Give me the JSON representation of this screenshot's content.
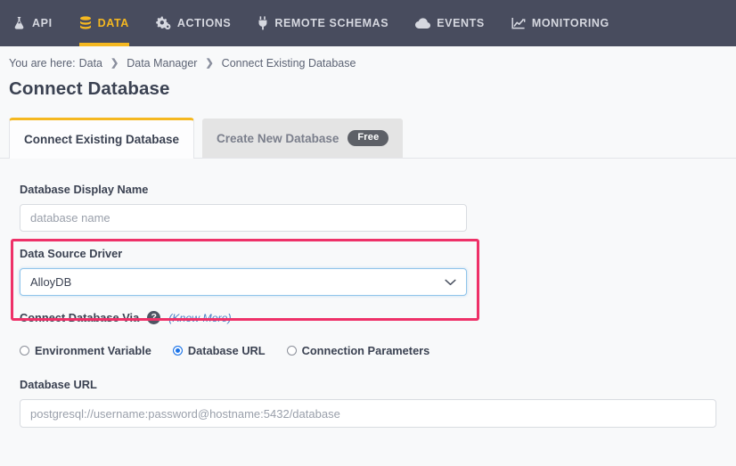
{
  "nav": {
    "items": [
      {
        "label": "API",
        "icon": "flask-icon",
        "active": false
      },
      {
        "label": "DATA",
        "icon": "database-icon",
        "active": true
      },
      {
        "label": "ACTIONS",
        "icon": "gears-icon",
        "active": false
      },
      {
        "label": "REMOTE SCHEMAS",
        "icon": "plug-icon",
        "active": false
      },
      {
        "label": "EVENTS",
        "icon": "cloud-icon",
        "active": false
      },
      {
        "label": "MONITORING",
        "icon": "line-chart-icon",
        "active": false
      }
    ],
    "active_color": "#f5b820",
    "background": "#484c5e"
  },
  "breadcrumb": {
    "prefix": "You are here:",
    "items": [
      "Data",
      "Data Manager",
      "Connect Existing Database"
    ],
    "separator": "❯"
  },
  "page": {
    "title": "Connect Database"
  },
  "tabs": [
    {
      "label": "Connect Existing Database",
      "active": true,
      "badge": null
    },
    {
      "label": "Create New Database",
      "active": false,
      "badge": "Free"
    }
  ],
  "form": {
    "display_name": {
      "label": "Database Display Name",
      "placeholder": "database name",
      "value": ""
    },
    "driver": {
      "label": "Data Source Driver",
      "selected": "AlloyDB",
      "chevron": "chevron-down-icon",
      "highlight_color": "#ee3168",
      "focus_color": "#8fc4ea"
    },
    "connect_via": {
      "label": "Connect Database Via",
      "help_icon": "?",
      "know_more_link": "(Know More)",
      "options": [
        {
          "label": "Environment Variable",
          "selected": false
        },
        {
          "label": "Database URL",
          "selected": true
        },
        {
          "label": "Connection Parameters",
          "selected": false
        }
      ],
      "selected_color": "#1a73e8"
    },
    "database_url": {
      "label": "Database URL",
      "placeholder": "postgresql://username:password@hostname:5432/database",
      "value": ""
    }
  }
}
